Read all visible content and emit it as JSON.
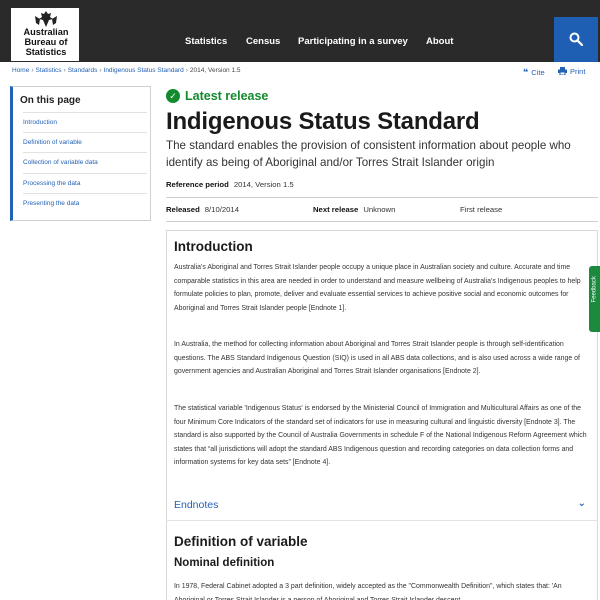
{
  "header": {
    "logo_lines": [
      "Australian",
      "Bureau of",
      "Statistics"
    ],
    "nav": [
      "Statistics",
      "Census",
      "Participating in a survey",
      "About"
    ],
    "search_icon": "search-icon"
  },
  "breadcrumb": {
    "items": [
      "Home",
      "Statistics",
      "Standards",
      "Indigenous Status Standard"
    ],
    "current": "2014, Version 1.5",
    "separator": "›"
  },
  "tools": {
    "cite": "Cite",
    "print": "Print"
  },
  "sidebar": {
    "title": "On this page",
    "items": [
      "Introduction",
      "Definition of variable",
      "Collection of variable data",
      "Processing the data",
      "Presenting the data"
    ]
  },
  "release": {
    "status": "Latest release",
    "title": "Indigenous Status Standard",
    "subtitle": "The standard enables the provision of consistent information about people who identify as being of Aboriginal and/or Torres Strait Islander origin",
    "reference_label": "Reference period",
    "reference_value": "2014, Version 1.5",
    "released_label": "Released",
    "released_value": "8/10/2014",
    "next_label": "Next release",
    "next_value": "Unknown",
    "first": "First release"
  },
  "content": {
    "intro_heading": "Introduction",
    "intro_paragraphs": [
      "Australia's Aboriginal and Torres Strait Islander people occupy a unique place in Australian society and culture. Accurate and time comparable statistics in this area are needed in order to understand and measure wellbeing of Australia's Indigenous peoples to help formulate policies to plan, promote, deliver and evaluate essential services to achieve positive social and economic outcomes for Aboriginal and Torres Strait Islander people [Endnote 1].",
      "In Australia, the method for collecting information about Aboriginal and Torres Strait Islander people is through self-identification questions. The ABS Standard Indigenous Question (SIQ) is used in all ABS data collections, and is also used across a wide range of government agencies and Australian Aboriginal and Torres Strait Islander organisations [Endnote 2].",
      "The statistical variable 'Indigenous Status' is endorsed by the Ministerial Council of Immigration and Multicultural Affairs as one of the four Minimum Core Indicators of the standard set of indicators for use in measuring cultural and linguistic diversity [Endnote 3]. The standard is also supported by the Council of Australia Governments in schedule F of the National Indigenous Reform Agreement which states that “all jurisdictions will adopt the standard ABS Indigenous question and recording categories on data collection forms and information systems for key data sets” [Endnote 4]."
    ],
    "endnotes": "Endnotes",
    "definition_heading": "Definition of variable",
    "nominal_heading": "Nominal definition",
    "nominal_paragraph": "In 1978, Federal Cabinet adopted a 3 part definition, widely accepted as the \"Commonwealth Definition\", which states that: 'An Aboriginal or Torres Strait Islander is a person of Aboriginal and Torres Strait Islander descent"
  },
  "feedback": "Feedback",
  "colors": {
    "header_bg": "#2a2a2a",
    "accent": "#2462b5",
    "search_bg": "#1e5fb3",
    "status_green": "#138a2e"
  }
}
